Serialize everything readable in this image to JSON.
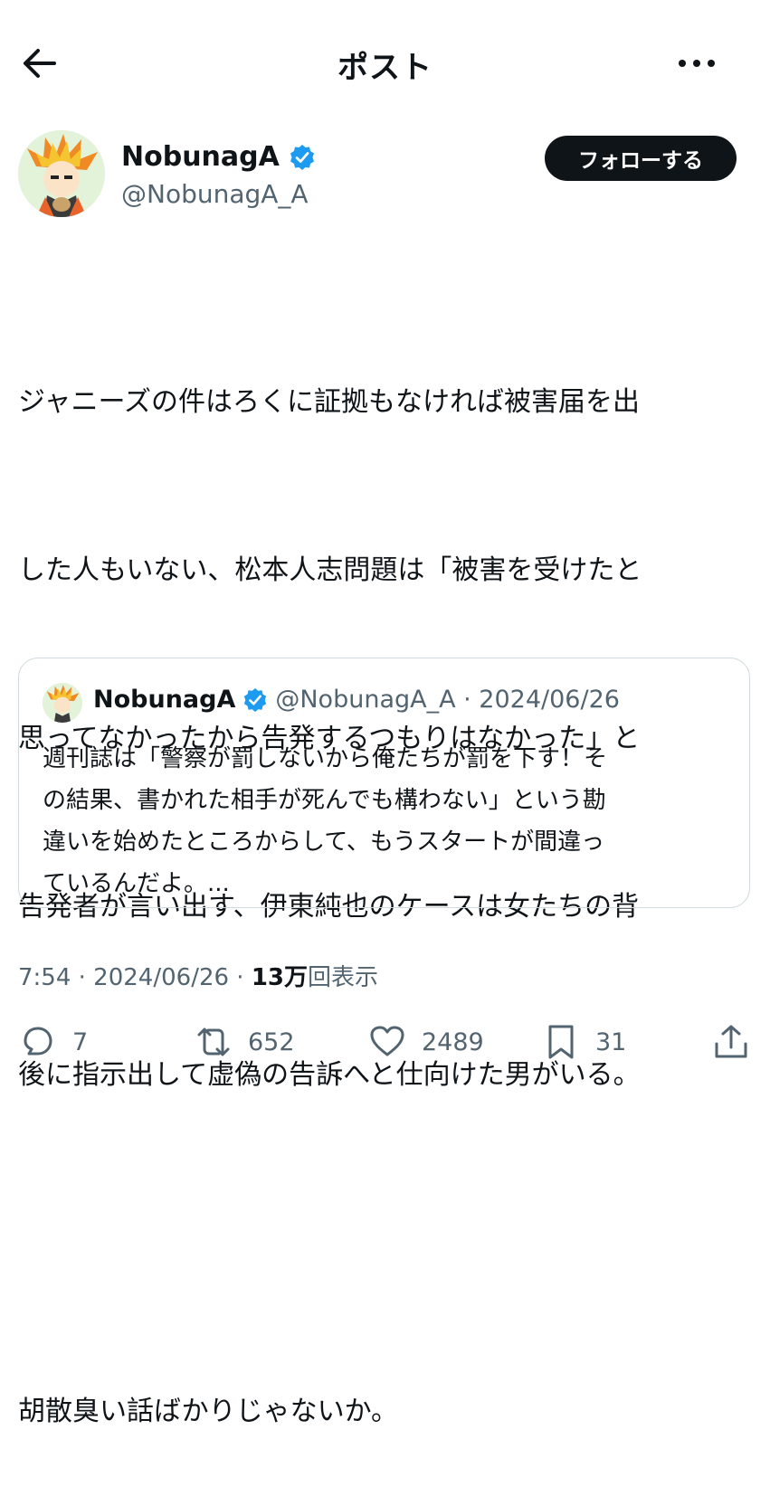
{
  "header": {
    "title": "ポスト",
    "back_icon": "arrow-left-icon",
    "more_icon": "more-horizontal-icon"
  },
  "author": {
    "display_name": "NobunagA",
    "handle": "@NobunagA_A",
    "verified": true,
    "follow_label": "フォローする"
  },
  "tweet": {
    "lines": [
      "ジャニーズの件はろくに証拠もなければ被害届を出",
      "した人もいない、松本人志問題は「被害を受けたと",
      "思ってなかったから告発するつもりはなかった」と",
      "告発者が言い出す、伊東純也のケースは女たちの背",
      "後に指示出して虚偽の告訴へと仕向けた男がいる。",
      "",
      "胡散臭い話ばかりじゃないか。"
    ]
  },
  "quote": {
    "display_name": "NobunagA",
    "meta": "@NobunagA_A · 2024/06/26",
    "lines": [
      "週刊誌は「警察が罰しないから俺たちが罰を下す！そ",
      "の結果、書かれた相手が死んでも構わない」という勘",
      "違いを始めたところからして、もうスタートが間違っ",
      "ているんだよ。..."
    ]
  },
  "meta": {
    "time_date": "7:54 · 2024/06/26 · ",
    "views_count": "13万",
    "views_label": "回表示"
  },
  "actions": {
    "reply_count": "7",
    "retweet_count": "652",
    "like_count": "2489",
    "bookmark_count": "31"
  },
  "colors": {
    "text": "#0f1419",
    "secondary": "#536471",
    "verified_blue": "#1d9bf0",
    "border": "#cfd9de"
  }
}
